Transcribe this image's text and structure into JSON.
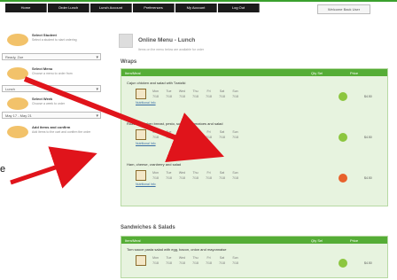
{
  "nav": [
    "Home",
    "Order Lunch",
    "Lunch Account",
    "Preferences",
    "My Account",
    "Log Out"
  ],
  "login_label": "Welcome Back User",
  "sidebar": {
    "steps": [
      {
        "title": "Select Student",
        "desc": "Select a student to start ordering"
      },
      {
        "title": "Select Menu",
        "desc": "Choose a menu to order from"
      },
      {
        "title": "Select Week",
        "desc": "Choose a week to order"
      },
      {
        "title": "Add items and confirm",
        "desc": "Add items to the cart and confirm the order"
      }
    ],
    "selects": [
      "Ready, Zoe",
      "Lunch",
      "May 17 - May 21"
    ]
  },
  "main": {
    "title": "Online Menu - Lunch",
    "subtitle": "Items on the menu below are available for order",
    "section1": "Wraps",
    "section2": "Sandwiches & Salads",
    "header": {
      "item": "Item/Meal",
      "qty": "Qty Sel",
      "price": "Price"
    },
    "days": [
      "Mon",
      "Tue",
      "Wed",
      "Thu",
      "Fri",
      "Sat",
      "Sun"
    ],
    "day_values": [
      "7/18",
      "7/18",
      "7/18",
      "7/18",
      "7/18",
      "7/18",
      "7/18"
    ],
    "rows": [
      {
        "name": "Cajun chicken and salad with Tzatziki",
        "link": "Nutritional Info",
        "status_color": "#8cc63f",
        "price": "$4.50"
      },
      {
        "name": "Roasted chicken breast, pesto, sun dried tomatoes and salad",
        "link": "Nutritional Info",
        "status_color": "#8cc63f",
        "price": "$4.50"
      },
      {
        "name": "Ham, cheese, cranberry and salad",
        "link": "Nutritional Info",
        "status_color": "#e8612c",
        "price": "$4.50"
      }
    ],
    "row2": {
      "name": "Tom sauce pasta salad with egg, bacon, onion and mayonnaise",
      "status_color": "#8cc63f",
      "price": "$4.50"
    }
  },
  "leftover_text": "e"
}
